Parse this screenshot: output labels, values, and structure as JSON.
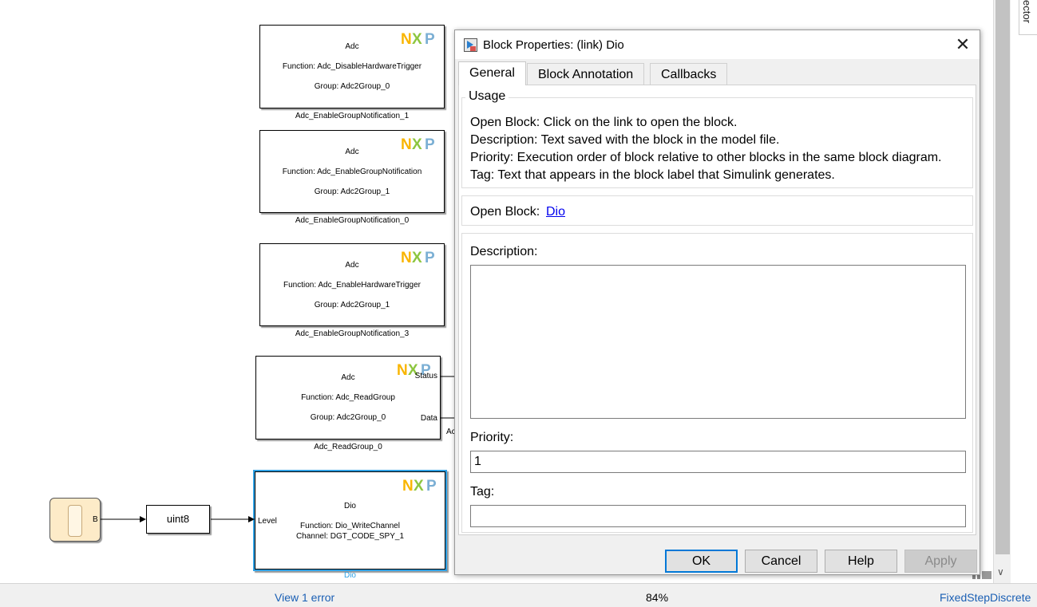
{
  "canvas": {
    "blocks": [
      {
        "id": "adc-disable",
        "title": "Adc",
        "function": "Function: Adc_DisableHardwareTrigger",
        "group": "Group: Adc2Group_0",
        "name": "Adc_EnableGroupNotification_1"
      },
      {
        "id": "adc-enable-notif",
        "title": "Adc",
        "function": "Function: Adc_EnableGroupNotification",
        "group": "Group: Adc2Group_1",
        "name": "Adc_EnableGroupNotification_0"
      },
      {
        "id": "adc-enable-hw",
        "title": "Adc",
        "function": "Function: Adc_EnableHardwareTrigger",
        "group": "Group: Adc2Group_1",
        "name": "Adc_EnableGroupNotification_3"
      },
      {
        "id": "adc-read",
        "title": "Adc",
        "function": "Function: Adc_ReadGroup",
        "group": "Group: Adc2Group_0",
        "name": "Adc_ReadGroup_0",
        "ports": {
          "status": "Status",
          "data": "Data"
        }
      }
    ],
    "dio_block": {
      "title": "Dio",
      "function": "Function: Dio_WriteChannel",
      "channel": "Channel: DGT_CODE_SPY_1",
      "port_in": "Level",
      "name": "Dio"
    },
    "stateflow": {
      "port_out": "B"
    },
    "convert_block": {
      "label": "uint8"
    },
    "partial_label": "Ac",
    "logo": "NXP"
  },
  "inspector_tab": {
    "label": "ector"
  },
  "statusbar": {
    "error": "View 1 error",
    "zoom": "84%",
    "solver": "FixedStepDiscrete"
  },
  "dialog": {
    "title": "Block Properties: (link) Dio",
    "close_icon": "close-icon",
    "tabs": [
      {
        "label": "General",
        "active": true
      },
      {
        "label": "Block Annotation",
        "active": false
      },
      {
        "label": "Callbacks",
        "active": false
      }
    ],
    "usage": {
      "title": "Usage",
      "lines": [
        "Open Block: Click on the link to open the block.",
        "Description: Text saved with the block in the model file.",
        "Priority: Execution order of block relative to other blocks in the same block diagram.",
        "Tag: Text that appears in the block label that Simulink generates."
      ]
    },
    "open_block": {
      "label": "Open Block:",
      "link": "Dio"
    },
    "description": {
      "label": "Description:",
      "value": ""
    },
    "priority": {
      "label": "Priority:",
      "value": "1"
    },
    "tag": {
      "label": "Tag:",
      "value": ""
    },
    "buttons": {
      "ok": "OK",
      "cancel": "Cancel",
      "help": "Help",
      "apply": "Apply"
    }
  },
  "colors": {
    "selection": "#2fa1e4",
    "link": "#0000ee",
    "nxp_n": "#f9b500",
    "nxp_x": "#8dc63f",
    "nxp_p": "#7bafd4"
  }
}
